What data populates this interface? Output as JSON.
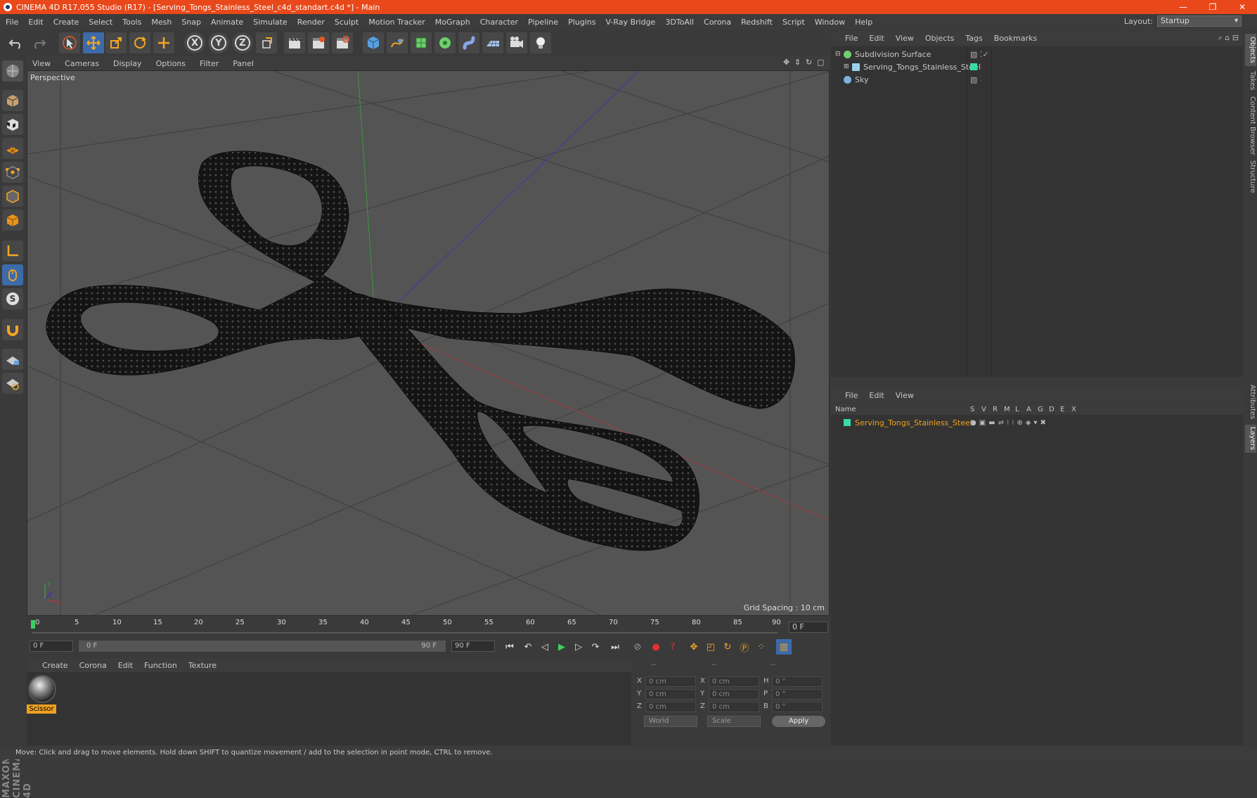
{
  "window": {
    "title": "CINEMA 4D R17.055 Studio (R17) - [Serving_Tongs_Stainless_Steel_c4d_standart.c4d *] - Main",
    "controls": [
      "—",
      "❐",
      "✕"
    ]
  },
  "menubar": {
    "items": [
      "File",
      "Edit",
      "Create",
      "Select",
      "Tools",
      "Mesh",
      "Snap",
      "Animate",
      "Simulate",
      "Render",
      "Sculpt",
      "Motion Tracker",
      "MoGraph",
      "Character",
      "Pipeline",
      "Plugins",
      "V-Ray Bridge",
      "3DToAll",
      "Corona",
      "Redshift",
      "Script",
      "Window",
      "Help"
    ],
    "layout_label": "Layout:",
    "layout_value": "Startup"
  },
  "toolbar": {
    "axis_x": "X",
    "axis_y": "Y",
    "axis_z": "Z"
  },
  "viewport": {
    "menu": [
      "View",
      "Cameras",
      "Display",
      "Options",
      "Filter",
      "Panel"
    ],
    "camera_label": "Perspective",
    "grid_spacing": "Grid Spacing : 10 cm"
  },
  "timeline": {
    "ticks": [
      "0",
      "5",
      "10",
      "15",
      "20",
      "25",
      "30",
      "35",
      "40",
      "45",
      "50",
      "55",
      "60",
      "65",
      "70",
      "75",
      "80",
      "85",
      "90"
    ],
    "current_frame": "0 F"
  },
  "transport": {
    "start_field": "0 F",
    "range_start": "0 F",
    "range_end": "90 F",
    "end_field": "90 F"
  },
  "material_manager": {
    "menu": [
      "Create",
      "Corona",
      "Edit",
      "Function",
      "Texture"
    ],
    "material_name": "Scissor"
  },
  "coordinates": {
    "headers": [
      "--",
      "--",
      "--"
    ],
    "rows": [
      {
        "l1": "X",
        "v1": "0 cm",
        "l2": "X",
        "v2": "0 cm",
        "l3": "H",
        "v3": "0 °"
      },
      {
        "l1": "Y",
        "v1": "0 cm",
        "l2": "Y",
        "v2": "0 cm",
        "l3": "P",
        "v3": "0 °"
      },
      {
        "l1": "Z",
        "v1": "0 cm",
        "l2": "Z",
        "v2": "0 cm",
        "l3": "B",
        "v3": "0 °"
      }
    ],
    "space": "World",
    "mode": "Scale",
    "apply_label": "Apply"
  },
  "object_manager": {
    "menu": [
      "File",
      "Edit",
      "View",
      "Objects",
      "Tags",
      "Bookmarks"
    ],
    "objects": [
      {
        "name": "Subdivision Surface",
        "color": "#6fcf6f"
      },
      {
        "name": "Serving_Tongs_Stainless_Steel",
        "color": "#9ad0e8"
      },
      {
        "name": "Sky",
        "color": "#7fb0e0"
      }
    ]
  },
  "layer_manager": {
    "menu": [
      "File",
      "Edit",
      "View"
    ],
    "columns": [
      "Name",
      "S",
      "V",
      "R",
      "M",
      "L",
      "A",
      "G",
      "D",
      "E",
      "X"
    ],
    "layers": [
      {
        "name": "Serving_Tongs_Stainless_Steel",
        "color": "#3adba8"
      }
    ]
  },
  "side_tabs": [
    "Objects",
    "Takes",
    "Content Browser",
    "Structure",
    "Attributes",
    "Layers"
  ],
  "status_text": "Move: Click and drag to move elements. Hold down SHIFT to quantize movement / add to the selection in point mode, CTRL to remove.",
  "colors": {
    "titlebar": "#e8481a",
    "accent_blue": "#3d6aa8",
    "layer_highlight": "#f0a020"
  }
}
